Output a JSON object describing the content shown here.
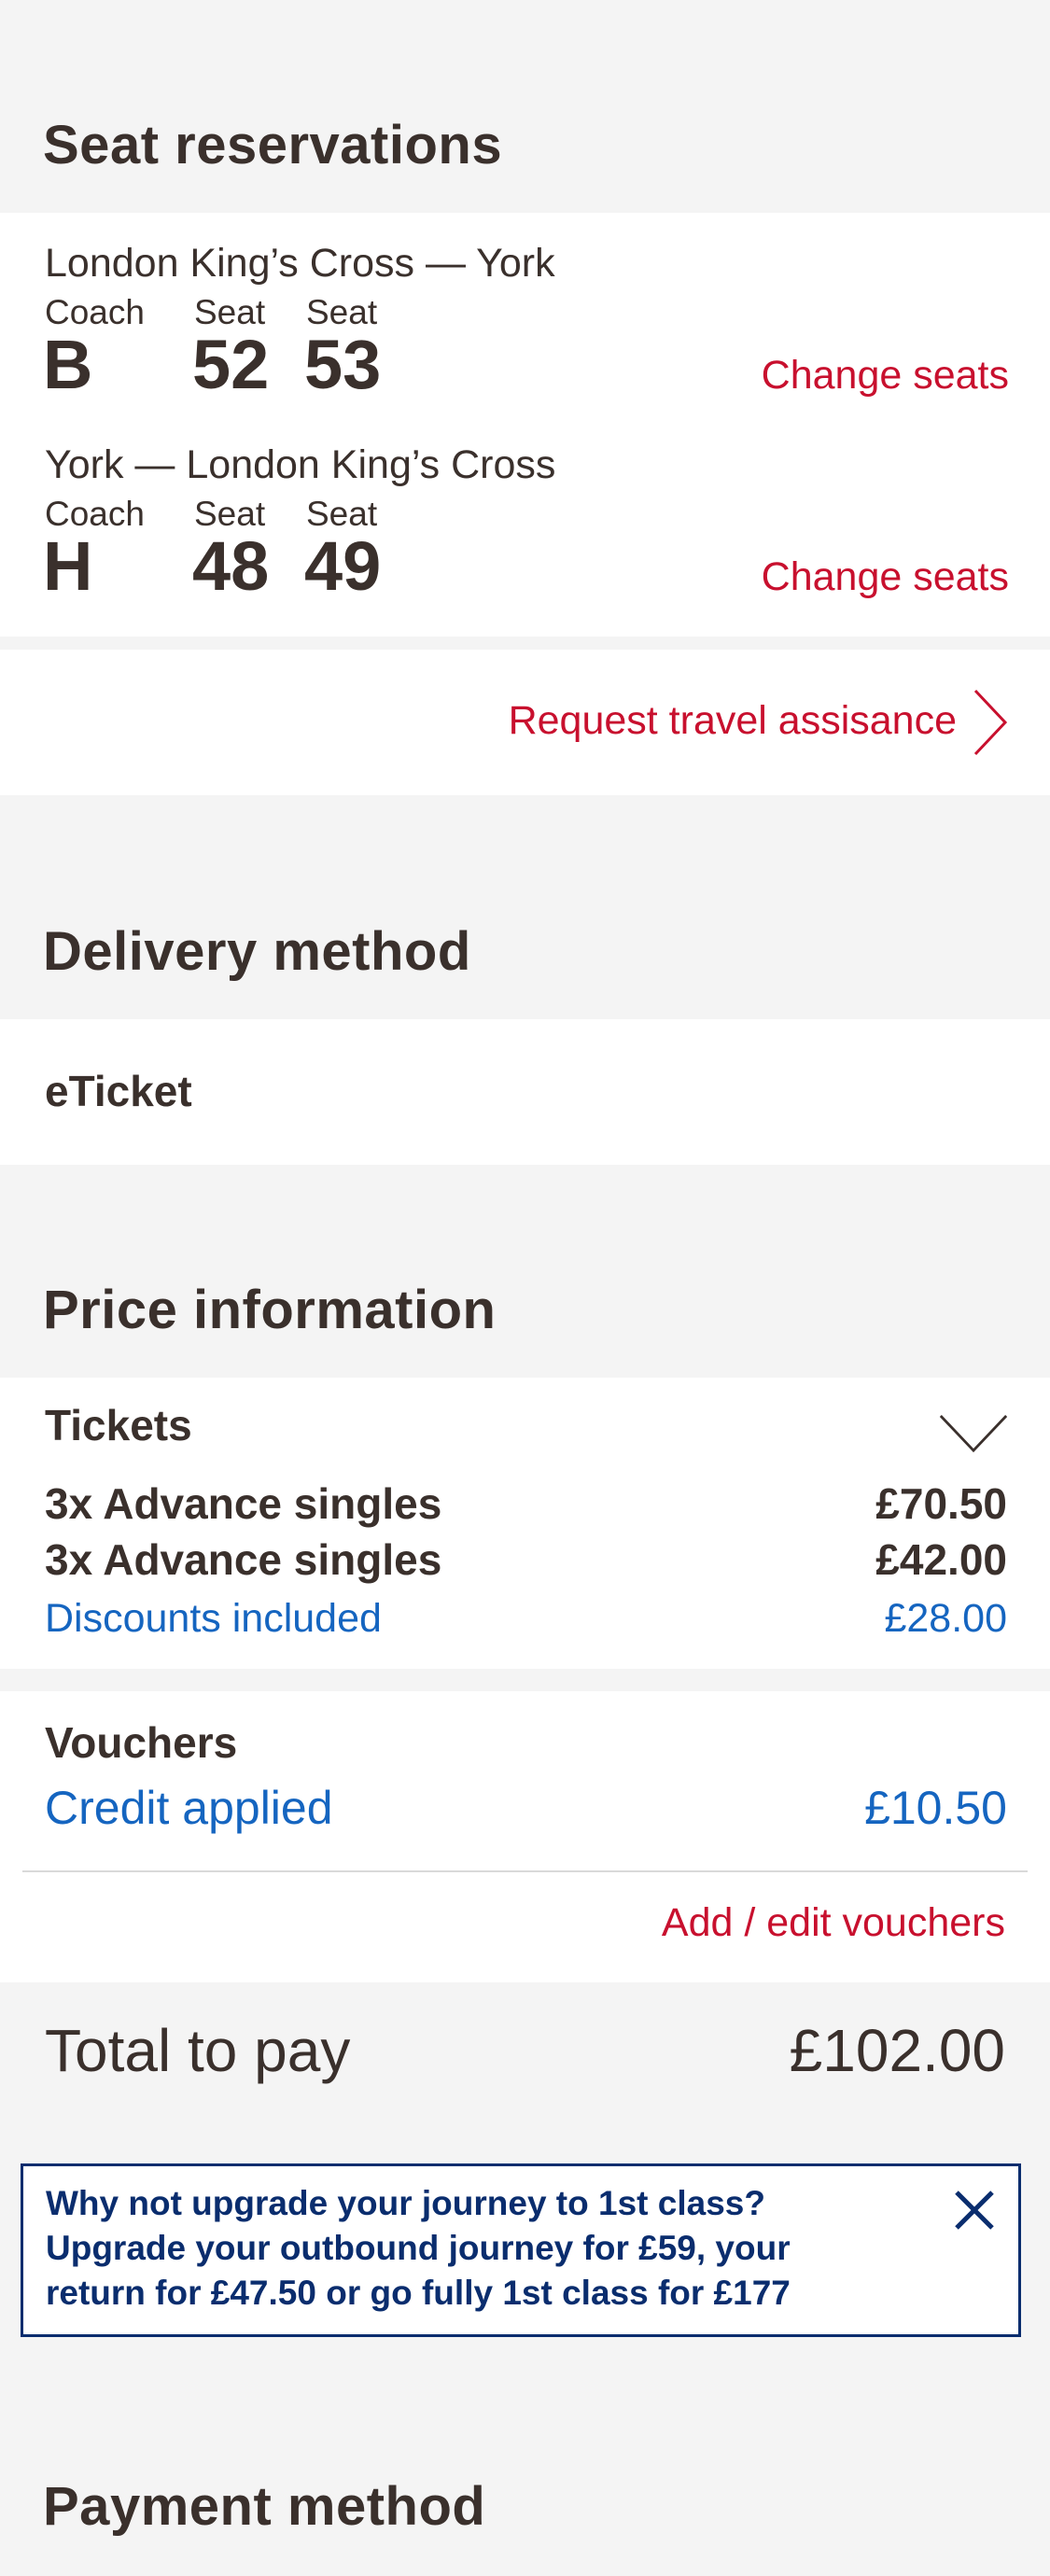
{
  "seat_reservations": {
    "title": "Seat reservations",
    "journeys": [
      {
        "route": "London King’s Cross — York",
        "coach_label": "Coach",
        "coach": "B",
        "seat_label_1": "Seat",
        "seat_1": "52",
        "seat_label_2": "Seat",
        "seat_2": "53",
        "change_label": "Change seats"
      },
      {
        "route": "York — London King’s Cross",
        "coach_label": "Coach",
        "coach": "H",
        "seat_label_1": "Seat",
        "seat_1": "48",
        "seat_label_2": "Seat",
        "seat_2": "49",
        "change_label": "Change seats"
      }
    ],
    "assistance_label": "Request travel assisance"
  },
  "delivery": {
    "title": "Delivery method",
    "method": "eTicket"
  },
  "price": {
    "title": "Price information",
    "tickets": {
      "heading": "Tickets",
      "lines": [
        {
          "label": "3x Advance singles",
          "amount": "£70.50"
        },
        {
          "label": "3x Advance singles",
          "amount": "£42.00"
        }
      ],
      "discount_label": "Discounts included",
      "discount_amount": "£28.00"
    },
    "vouchers": {
      "heading": "Vouchers",
      "credit_label": "Credit applied",
      "credit_amount": "£10.50",
      "edit_label": "Add / edit vouchers"
    },
    "total_label": "Total to pay",
    "total_amount": "£102.00"
  },
  "promo": {
    "text": "Why not upgrade your journey to 1st class? Upgrade your outbound journey for £59, your return for £47.50 or go fully 1st class for £177",
    "close_icon": "close-icon"
  },
  "payment": {
    "title": "Payment method"
  },
  "colors": {
    "accent_red": "#c8102e",
    "link_blue": "#1565c0",
    "promo_navy": "#0a2d6e",
    "text_dark": "#3a302c",
    "background": "#f4f4f4"
  }
}
